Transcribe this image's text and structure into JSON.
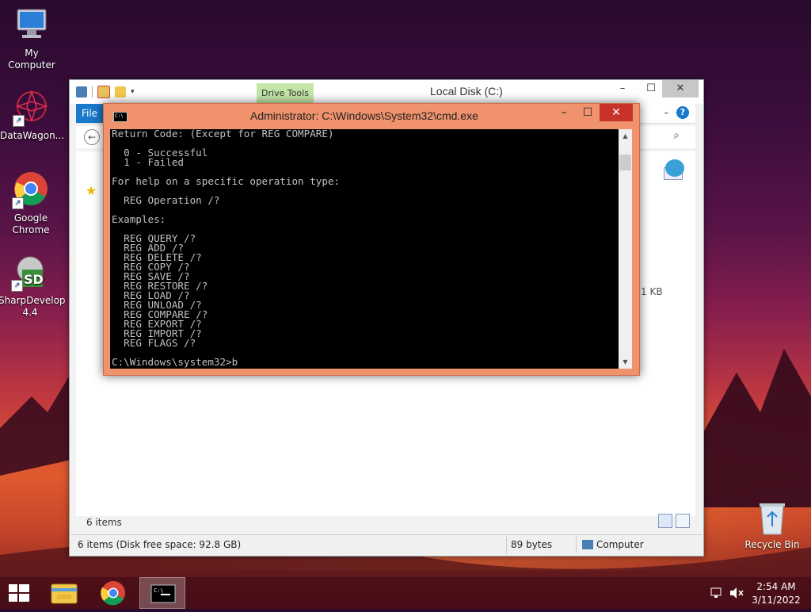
{
  "desktop": {
    "icons": [
      {
        "label": "My Computer"
      },
      {
        "label": "DataWagon..."
      },
      {
        "label": "Google Chrome"
      },
      {
        "label": "SharpDevelop 4.4"
      },
      {
        "label": "Recycle Bin"
      }
    ]
  },
  "explorer": {
    "title": "Local Disk (C:)",
    "contextual_tab": "Drive Tools",
    "file_tab": "File",
    "help": "?",
    "size_cell": "1 KB",
    "items_count": "6 items",
    "status": {
      "left": "6 items (Disk free space: 92.8 GB)",
      "middle": "89 bytes",
      "right": "Computer"
    }
  },
  "cmd": {
    "title": "Administrator: C:\\Windows\\System32\\cmd.exe",
    "icon_text": "C:\\",
    "lines": [
      "Return Code: (Except for REG COMPARE)",
      "",
      "  0 - Successful",
      "  1 - Failed",
      "",
      "For help on a specific operation type:",
      "",
      "  REG Operation /?",
      "",
      "Examples:",
      "",
      "  REG QUERY /?",
      "  REG ADD /?",
      "  REG DELETE /?",
      "  REG COPY /?",
      "  REG SAVE /?",
      "  REG RESTORE /?",
      "  REG LOAD /?",
      "  REG UNLOAD /?",
      "  REG COMPARE /?",
      "  REG EXPORT /?",
      "  REG IMPORT /?",
      "  REG FLAGS /?",
      "",
      "C:\\Windows\\system32>b"
    ]
  },
  "taskbar": {
    "time": "2:54 AM",
    "date": "3/11/2022",
    "items": [
      {
        "icon": "start-icon"
      },
      {
        "icon": "file-explorer-icon"
      },
      {
        "icon": "chrome-icon"
      },
      {
        "icon": "cmd-icon",
        "active": true
      }
    ]
  }
}
